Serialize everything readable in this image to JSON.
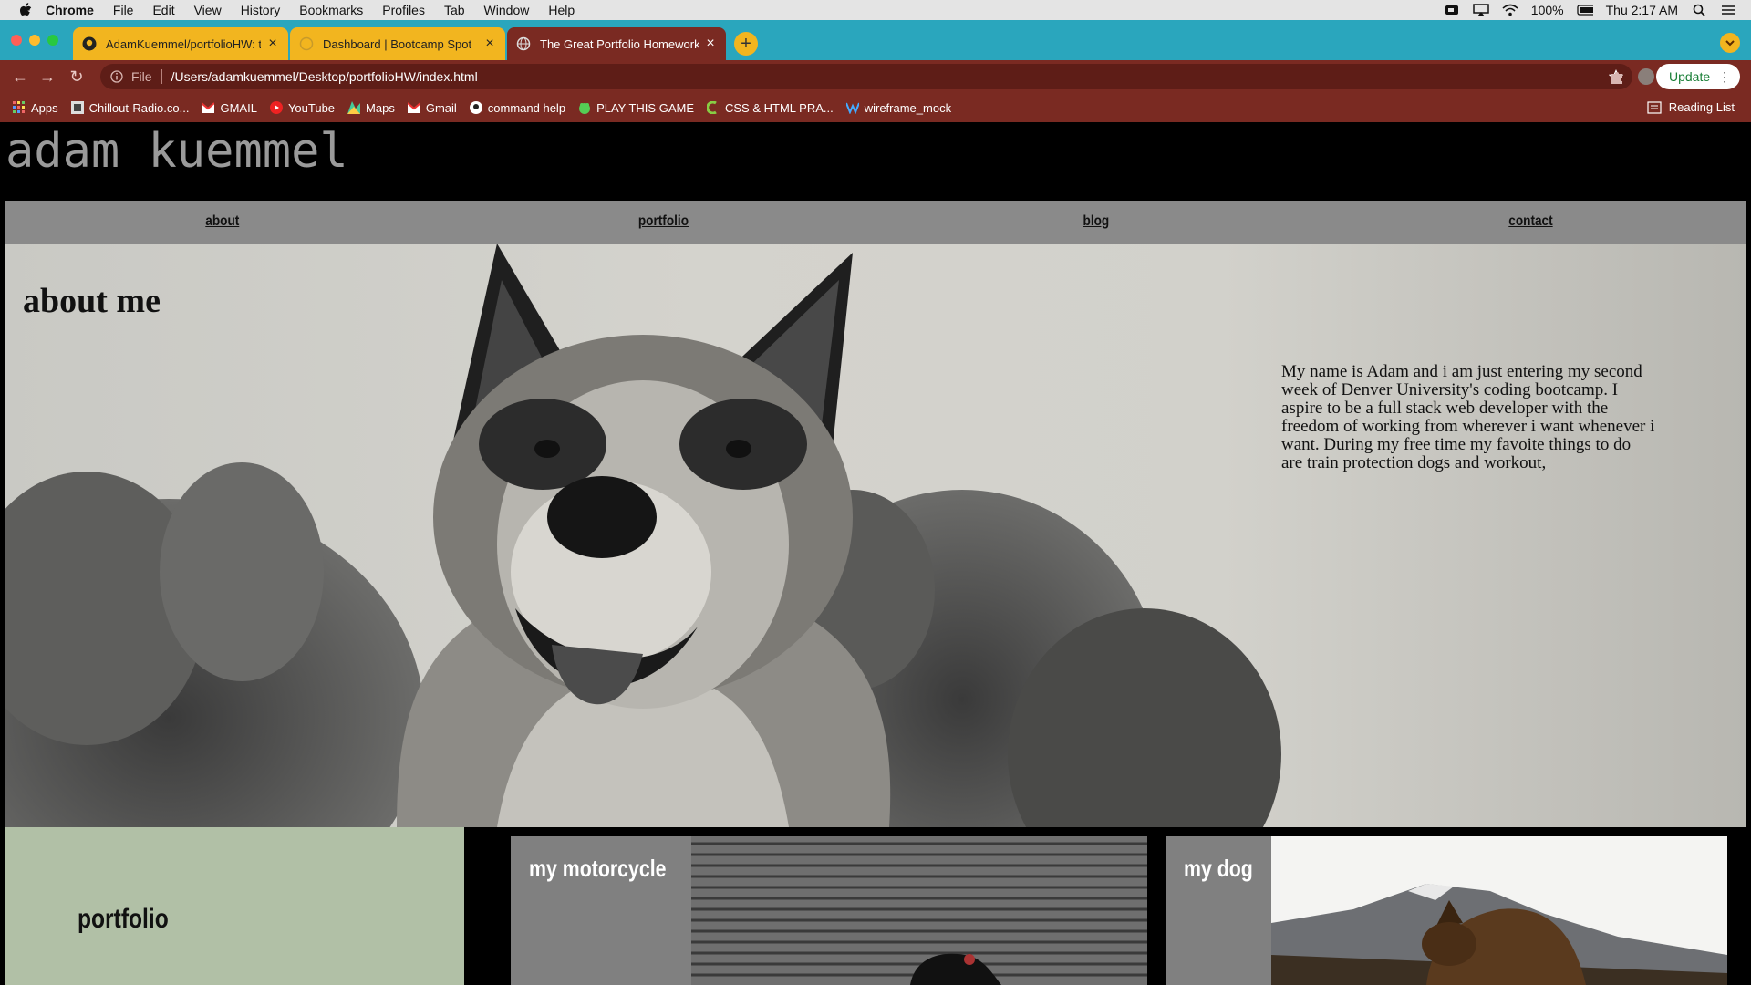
{
  "menubar": {
    "app": "Chrome",
    "items": [
      "File",
      "Edit",
      "View",
      "History",
      "Bookmarks",
      "Profiles",
      "Tab",
      "Window",
      "Help"
    ],
    "battery": "100%",
    "clock": "Thu 2:17 AM"
  },
  "tabs": [
    {
      "title": "AdamKuemmel/portfolioHW: th",
      "active": false
    },
    {
      "title": "Dashboard | Bootcamp Spot",
      "active": false
    },
    {
      "title": "The Great Portfolio Homework",
      "active": true
    }
  ],
  "toolbar": {
    "scheme": "File",
    "url": "/Users/adamkuemmel/Desktop/portfolioHW/index.html",
    "update_label": "Update"
  },
  "bookmarks": {
    "items": [
      "Apps",
      "Chillout-Radio.co...",
      "GMAIL",
      "YouTube",
      "Maps",
      "Gmail",
      "command help",
      "PLAY THIS GAME",
      "CSS & HTML PRA...",
      "wireframe_mock"
    ],
    "reading_list": "Reading List"
  },
  "site": {
    "title": "adam kuemmel",
    "nav": [
      "about",
      "portfolio",
      "blog",
      "contact"
    ],
    "about_heading": "about me",
    "about_text": "My name is Adam and i am just entering my second week of Denver University's coding bootcamp. I aspire to be a full stack web developer with the freedom of working from wherever i want whenever i want. During my free time my favoite things to do are train protection dogs and workout,",
    "portfolio_label": "portfolio",
    "cards": [
      "my motorcycle",
      "my dog"
    ]
  },
  "colors": {
    "tabstrip": "#2aa6bd",
    "tab_inactive": "#f2b51f",
    "toolbar": "#7a2a22",
    "nav_bg": "#8a8a8a",
    "portfolio_bg": "#b1c0a6",
    "card_bg": "#808080"
  }
}
